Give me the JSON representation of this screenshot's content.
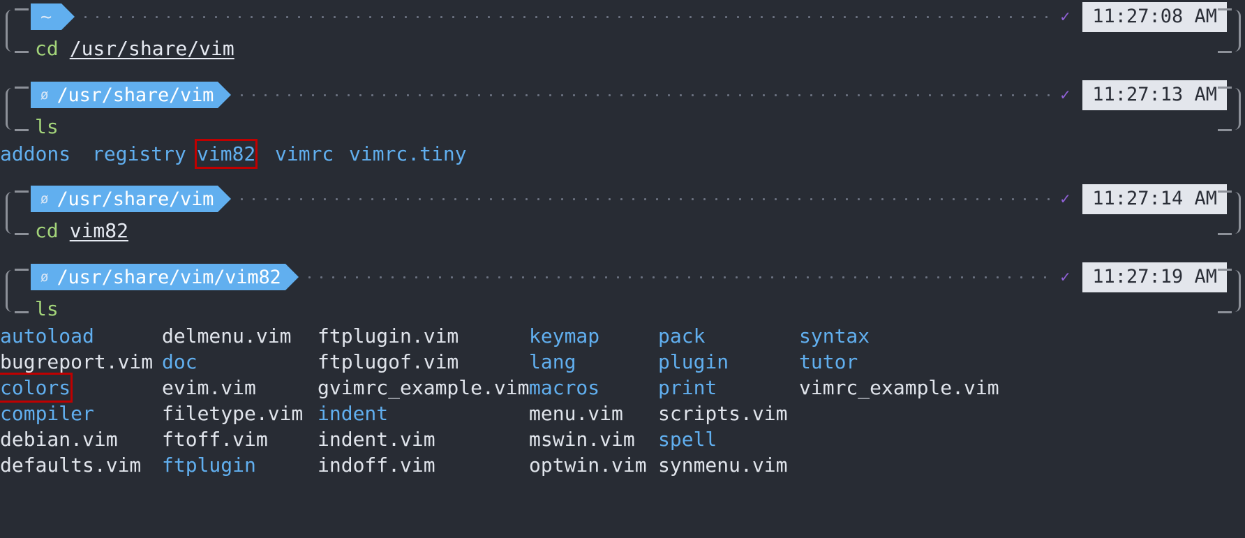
{
  "theme": {
    "background": "#282c34",
    "powerline_bg": "#61afef",
    "powerline_fg": "#ffffff",
    "bracket": "#8d9199",
    "dots": "#6b7180",
    "check": "#9061d6",
    "timestamp_bg": "#e3e6ec",
    "timestamp_fg": "#2b2f38",
    "command_name": "#a3d47a",
    "command_arg": "#e6eaf2",
    "dir_color": "#61afef",
    "file_color": "#e0e4eb",
    "highlight_border": "#c00000"
  },
  "blocks": [
    {
      "prompt": {
        "mark": "~",
        "path": "",
        "status_icon": "check-icon",
        "timestamp": "11:27:08 AM"
      },
      "command": {
        "name": "cd",
        "arg": "/usr/share/vim"
      },
      "output": null
    },
    {
      "prompt": {
        "mark": "ø",
        "path": "/usr/share/vim",
        "status_icon": "check-icon",
        "timestamp": "11:27:13 AM"
      },
      "command": {
        "name": "ls",
        "arg": ""
      },
      "output": {
        "columns": 5,
        "rows": [
          [
            {
              "text": "addons",
              "kind": "dir",
              "highlight": false,
              "width": 11
            },
            {
              "text": "registry",
              "kind": "dir",
              "highlight": false,
              "width": 12
            },
            {
              "text": "vim82",
              "kind": "dir",
              "highlight": true,
              "width": 9
            },
            {
              "text": "vimrc",
              "kind": "dir",
              "highlight": false,
              "width": 9
            },
            {
              "text": "vimrc.tiny",
              "kind": "dir",
              "highlight": false,
              "width": 10
            }
          ]
        ]
      }
    },
    {
      "prompt": {
        "mark": "ø",
        "path": "/usr/share/vim",
        "status_icon": "check-icon",
        "timestamp": "11:27:14 AM"
      },
      "command": {
        "name": "cd",
        "arg": "vim82"
      },
      "output": null
    },
    {
      "prompt": {
        "mark": "ø",
        "path": "/usr/share/vim/vim82",
        "status_icon": "check-icon",
        "timestamp": "11:27:19 AM"
      },
      "command": {
        "name": "ls",
        "arg": ""
      },
      "output": {
        "columns": 6,
        "rows": [
          [
            {
              "text": "autoload",
              "kind": "dir",
              "highlight": false
            },
            {
              "text": "delmenu.vim",
              "kind": "file",
              "highlight": false
            },
            {
              "text": "ftplugin.vim",
              "kind": "file",
              "highlight": false
            },
            {
              "text": "keymap",
              "kind": "dir",
              "highlight": false
            },
            {
              "text": "pack",
              "kind": "dir",
              "highlight": false
            },
            {
              "text": "syntax",
              "kind": "dir",
              "highlight": false
            }
          ],
          [
            {
              "text": "bugreport.vim",
              "kind": "file",
              "highlight": false
            },
            {
              "text": "doc",
              "kind": "dir",
              "highlight": false
            },
            {
              "text": "ftplugof.vim",
              "kind": "file",
              "highlight": false
            },
            {
              "text": "lang",
              "kind": "dir",
              "highlight": false
            },
            {
              "text": "plugin",
              "kind": "dir",
              "highlight": false
            },
            {
              "text": "tutor",
              "kind": "dir",
              "highlight": false
            }
          ],
          [
            {
              "text": "colors",
              "kind": "dir",
              "highlight": true
            },
            {
              "text": "evim.vim",
              "kind": "file",
              "highlight": false
            },
            {
              "text": "gvimrc_example.vim",
              "kind": "file",
              "highlight": false
            },
            {
              "text": "macros",
              "kind": "dir",
              "highlight": false
            },
            {
              "text": "print",
              "kind": "dir",
              "highlight": false
            },
            {
              "text": "vimrc_example.vim",
              "kind": "file",
              "highlight": false
            }
          ],
          [
            {
              "text": "compiler",
              "kind": "dir",
              "highlight": false
            },
            {
              "text": "filetype.vim",
              "kind": "file",
              "highlight": false
            },
            {
              "text": "indent",
              "kind": "dir",
              "highlight": false
            },
            {
              "text": "menu.vim",
              "kind": "file",
              "highlight": false
            },
            {
              "text": "scripts.vim",
              "kind": "file",
              "highlight": false
            },
            {
              "text": "",
              "kind": "file",
              "highlight": false
            }
          ],
          [
            {
              "text": "debian.vim",
              "kind": "file",
              "highlight": false
            },
            {
              "text": "ftoff.vim",
              "kind": "file",
              "highlight": false
            },
            {
              "text": "indent.vim",
              "kind": "file",
              "highlight": false
            },
            {
              "text": "mswin.vim",
              "kind": "file",
              "highlight": false
            },
            {
              "text": "spell",
              "kind": "dir",
              "highlight": false
            },
            {
              "text": "",
              "kind": "file",
              "highlight": false
            }
          ],
          [
            {
              "text": "defaults.vim",
              "kind": "file",
              "highlight": false
            },
            {
              "text": "ftplugin",
              "kind": "dir",
              "highlight": false
            },
            {
              "text": "indoff.vim",
              "kind": "file",
              "highlight": false
            },
            {
              "text": "optwin.vim",
              "kind": "file",
              "highlight": false
            },
            {
              "text": "synmenu.vim",
              "kind": "file",
              "highlight": false
            },
            {
              "text": "",
              "kind": "file",
              "highlight": false
            }
          ]
        ]
      }
    }
  ]
}
